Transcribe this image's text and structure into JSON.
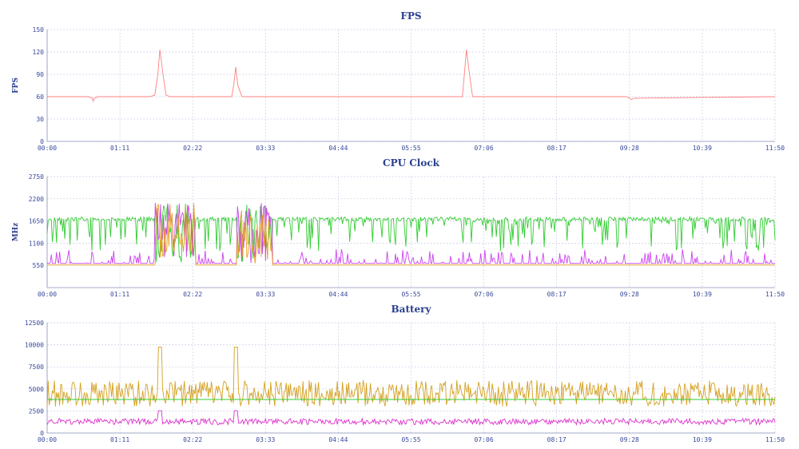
{
  "chart_data": [
    {
      "type": "line",
      "title": "FPS",
      "ylabel": "FPS",
      "ylim": [
        0,
        150
      ],
      "yticks": [
        "0",
        "30",
        "60",
        "90",
        "120",
        "150"
      ],
      "xlim": [
        0,
        710
      ],
      "xticks": [
        "00:00",
        "01:11",
        "02:22",
        "03:33",
        "04:44",
        "05:55",
        "07:06",
        "08:17",
        "09:28",
        "10:39",
        "11:50"
      ],
      "grid": true,
      "series": [
        {
          "color": "#ff7f7f",
          "x": [
            0,
            40,
            44,
            45,
            46,
            50,
            100,
            105,
            108,
            110,
            113,
            116,
            120,
            180,
            182,
            184,
            186,
            190,
            400,
            405,
            407,
            409,
            412,
            415,
            565,
            568,
            570,
            572,
            710
          ],
          "y": [
            60,
            60,
            58,
            54,
            58,
            60,
            60,
            62,
            90,
            123,
            90,
            62,
            60,
            60,
            75,
            100,
            75,
            60,
            60,
            60,
            90,
            123,
            90,
            60,
            60,
            58,
            56,
            58,
            60
          ]
        }
      ]
    },
    {
      "type": "line",
      "title": "CPU Clock",
      "ylabel": "MHz",
      "ylim": [
        0,
        2750
      ],
      "yticks": [
        "550",
        "1100",
        "1650",
        "2200",
        "2750"
      ],
      "xlim": [
        0,
        710
      ],
      "xticks": [
        "00:00",
        "01:11",
        "02:22",
        "03:33",
        "04:44",
        "05:55",
        "07:06",
        "08:17",
        "09:28",
        "10:39",
        "11:50"
      ],
      "grid": true,
      "series": [
        {
          "color": "#33cc33",
          "base": 1700,
          "low": 900,
          "seed": 11
        },
        {
          "color": "#cc44ee",
          "base": 600,
          "high": 950,
          "seed": 23
        },
        {
          "color": "#e6a020",
          "base": 560,
          "seed": 37
        }
      ]
    },
    {
      "type": "line",
      "title": "Battery",
      "ylabel": "",
      "ylim": [
        0,
        12500
      ],
      "yticks": [
        "0",
        "2500",
        "5000",
        "7500",
        "10000",
        "12500"
      ],
      "xlim": [
        0,
        710
      ],
      "xticks": [
        "00:00",
        "01:11",
        "02:22",
        "03:33",
        "04:44",
        "05:55",
        "07:06",
        "08:17",
        "09:28",
        "10:39",
        "11:50"
      ],
      "grid": true,
      "series": [
        {
          "color": "#d4a020",
          "base": 4500,
          "amp": 1500,
          "seed": 53
        },
        {
          "color": "#33cc33",
          "base": 3800,
          "amp": 0,
          "seed": 61
        },
        {
          "color": "#dd33cc",
          "base": 1300,
          "amp": 350,
          "seed": 71
        }
      ]
    }
  ]
}
